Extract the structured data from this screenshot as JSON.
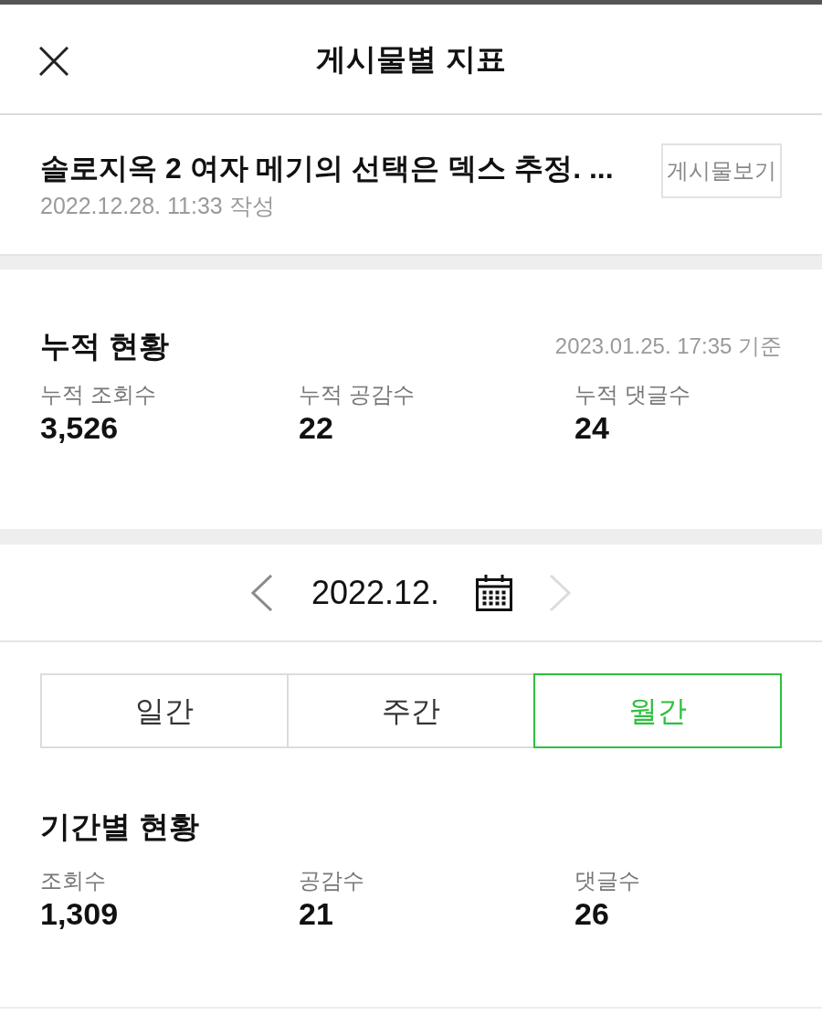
{
  "header": {
    "title": "게시물별 지표"
  },
  "post": {
    "title": "솔로지옥 2 여자 메기의 선택은 덱스 추정. ...",
    "written": "2022.12.28. 11:33 작성",
    "view_button": "게시물보기"
  },
  "cumulative": {
    "title": "누적 현황",
    "as_of": "2023.01.25. 17:35 기준",
    "stats": [
      {
        "label": "누적 조회수",
        "value": "3,526"
      },
      {
        "label": "누적 공감수",
        "value": "22"
      },
      {
        "label": "누적 댓글수",
        "value": "24"
      }
    ]
  },
  "period_nav": {
    "label": "2022.12.",
    "prev": {
      "disabled": false
    },
    "next": {
      "disabled": true
    }
  },
  "tabs": [
    {
      "label": "일간",
      "selected": false
    },
    {
      "label": "주간",
      "selected": false
    },
    {
      "label": "월간",
      "selected": true
    }
  ],
  "period": {
    "title": "기간별 현황",
    "stats": [
      {
        "label": "조회수",
        "value": "1,309"
      },
      {
        "label": "공감수",
        "value": "21"
      },
      {
        "label": "댓글수",
        "value": "26"
      }
    ]
  }
}
